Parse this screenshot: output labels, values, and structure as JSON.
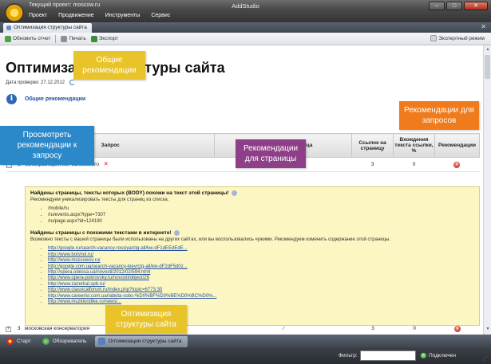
{
  "window": {
    "project_title": "Текущий проект: moscow.ru",
    "title": "AddStudio",
    "minimize": "–",
    "maximize": "□",
    "close": "✕"
  },
  "menu": [
    "Проект",
    "Продвижение",
    "Инструменты",
    "Сервис"
  ],
  "doc_tab": {
    "label": "Оптимизация структуры сайта",
    "close": "✕"
  },
  "toolbar": {
    "refresh": "Обновить отчет",
    "print": "Печать",
    "export": "Экспорт",
    "expert": "Экспертный режим"
  },
  "page": {
    "title": "Оптимизация структуры сайта",
    "check_date": "Дата проверки: 27.12.2012",
    "general_link": "Общие рекомендации"
  },
  "table": {
    "headers": [
      "Запрос",
      "Релевантная страница",
      "Ссылок на страницу",
      "Вхождения текста ссылки, %",
      "Рекомендации"
    ],
    "rows": [
      {
        "num": "2",
        "query": "консерватория им чайковского",
        "link": "/",
        "links": "3",
        "percent": "0"
      },
      {
        "num": "3",
        "query": "московская консерватория",
        "link": "/",
        "links": "3",
        "percent": "0"
      }
    ]
  },
  "details": {
    "h1": "Найдены страницы, тексты которых (BODY) похожи на текст этой страницы!",
    "sub1": "Рекомендуем уникализировать тексты для страниц из списка.",
    "pages": [
      "/mobile/ru",
      "/ru/events.aspx?type=7307",
      "/ru/page.aspx?id=124190"
    ],
    "h2": "Найдены страницы с похожими текстами в интернете!",
    "sub2": "Возможно тексты с вашей страницы были использованы на других сайтах, или вы воспользовались чужими. Рекомендуем изменить содержание этой страницы.",
    "links": [
      "http://google.ru/search-vacancy-rossiya/ctg-all/kw-dF1dEEdEdE...",
      "http://www.bolshoi.ru/",
      "http://www.moscowsv.ru/",
      "http://google.com.ua/search-vacancy-kiev/ctg-all/kw-dF2dF5d0z...",
      "http://opera.odessa.ua/novosti/2012/02/594.html",
      "http://www.opera-pokrovsky.ru/novosti/object/26",
      "http://www.zazerkal.spb.ru/",
      "http://www.classicalforum.ru/index.php?topic=6773.30",
      "http://www.careerist.com.ua/rabota-sobs-%D0%BF%D0%BE%D0%BC%D0%...",
      "http://www.muzklondike.ru/news/..."
    ]
  },
  "callouts": {
    "general": "Общие рекомендации",
    "view": "Просмотреть рекомендации к запросу",
    "page_rec": "Рекомендации для страницы",
    "query_rec": "Рекомендации для запросов",
    "structure": "Оптимизация структуры сайта"
  },
  "taskbar": [
    "Старт",
    "Обозреватель",
    "Оптимизация структуры сайта"
  ],
  "status": {
    "filter_label": "Фильтр:",
    "filter_value": "",
    "connection": "Подключен"
  },
  "colors": {
    "callout_yellow": "#e8c42a",
    "callout_blue": "#2c89c9",
    "callout_purple": "#8e3f87",
    "callout_orange": "#ef7b1d",
    "link": "#1f4f9e",
    "error": "#c11a0a",
    "detail_bg": "#fcf6c2"
  }
}
